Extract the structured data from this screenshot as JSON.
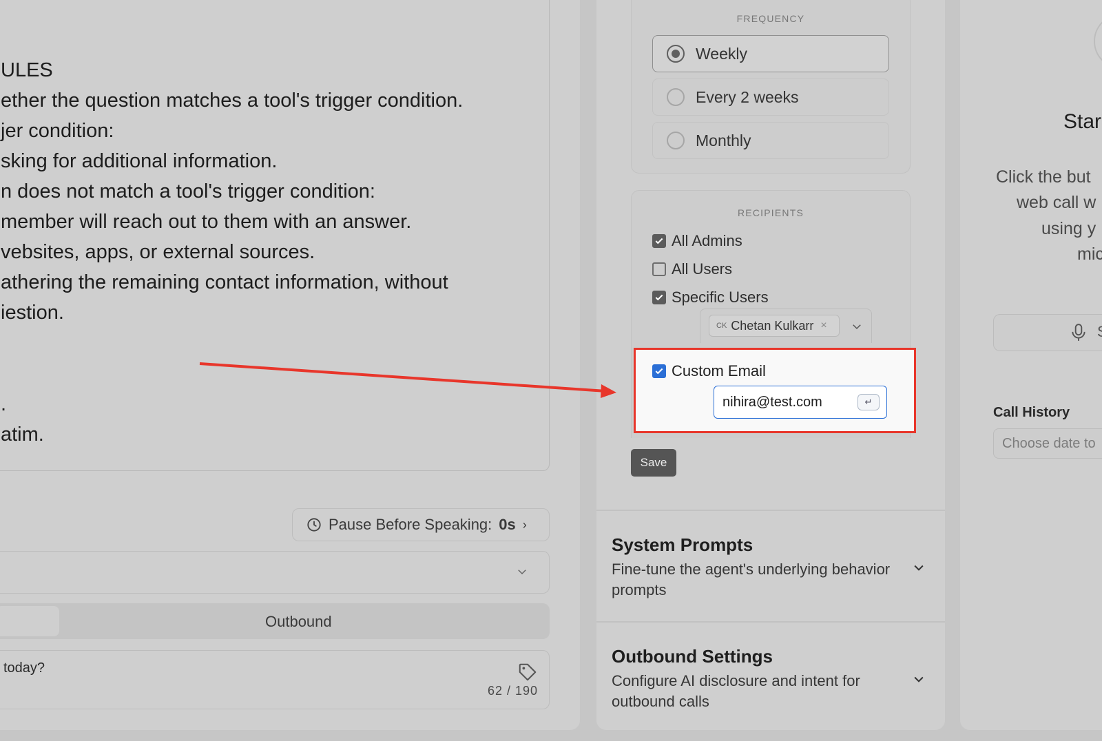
{
  "prompt": {
    "lines": [
      "ULES",
      "ether the question matches a tool's trigger condition.",
      "jer condition:",
      "sking for additional information.",
      "n does not match a tool's trigger condition:",
      "member will reach out to them with an answer.",
      "vebsites, apps, or external sources.",
      "athering the remaining contact information, without",
      "iestion.",
      ".",
      "atim."
    ]
  },
  "pause_button": {
    "label": "Pause Before Speaking:",
    "value": "0s",
    "chevron": "›"
  },
  "tabs": {
    "outbound": "Outbound"
  },
  "message": {
    "text": "today?",
    "count": "62 / 190"
  },
  "frequency": {
    "title": "FREQUENCY",
    "options": [
      {
        "label": "Weekly",
        "selected": true
      },
      {
        "label": "Every 2 weeks",
        "selected": false
      },
      {
        "label": "Monthly",
        "selected": false
      }
    ]
  },
  "recipients": {
    "title": "RECIPIENTS",
    "all_admins": {
      "label": "All Admins",
      "checked": true
    },
    "all_users": {
      "label": "All Users",
      "checked": false
    },
    "specific_users": {
      "label": "Specific Users",
      "checked": true
    },
    "selected_user": {
      "initials": "CK",
      "name": "Chetan Kulkarr"
    },
    "custom_email": {
      "label": "Custom Email",
      "checked": true,
      "value": "nihira@test.com"
    }
  },
  "save_label": "Save",
  "system_prompts": {
    "title": "System Prompts",
    "description": "Fine-tune the agent's underlying behavior prompts"
  },
  "outbound_settings": {
    "title": "Outbound Settings",
    "description": "Configure AI disclosure and intent for outbound calls"
  },
  "right": {
    "title": "Star",
    "lines": [
      "Click the but",
      "web call w",
      "using y",
      "mic"
    ],
    "button_text": "S",
    "call_history_label": "Call History",
    "date_placeholder": "Choose date to"
  },
  "colors": {
    "highlight": "#e8362b",
    "checkbox_blue": "#2b6fd6",
    "save_bg": "#555555"
  },
  "icons": [
    "clock-icon",
    "chevron-down-icon",
    "tag-icon",
    "check-icon",
    "close-icon",
    "enter-key-icon",
    "microphone-icon",
    "annotation-arrow"
  ]
}
